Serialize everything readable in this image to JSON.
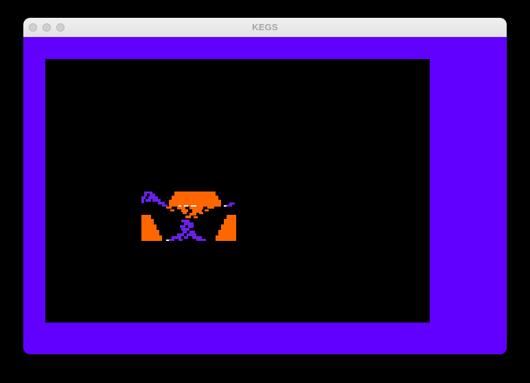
{
  "window": {
    "title": "KEGS"
  },
  "colors": {
    "border": "#6200ff",
    "screen": "#000000",
    "orange": "#ff6600",
    "violet": "#6a20e8",
    "white": "#ffffff"
  },
  "icons": {
    "close": "traffic-light-close",
    "minimize": "traffic-light-minimize",
    "zoom": "traffic-light-zoom"
  }
}
